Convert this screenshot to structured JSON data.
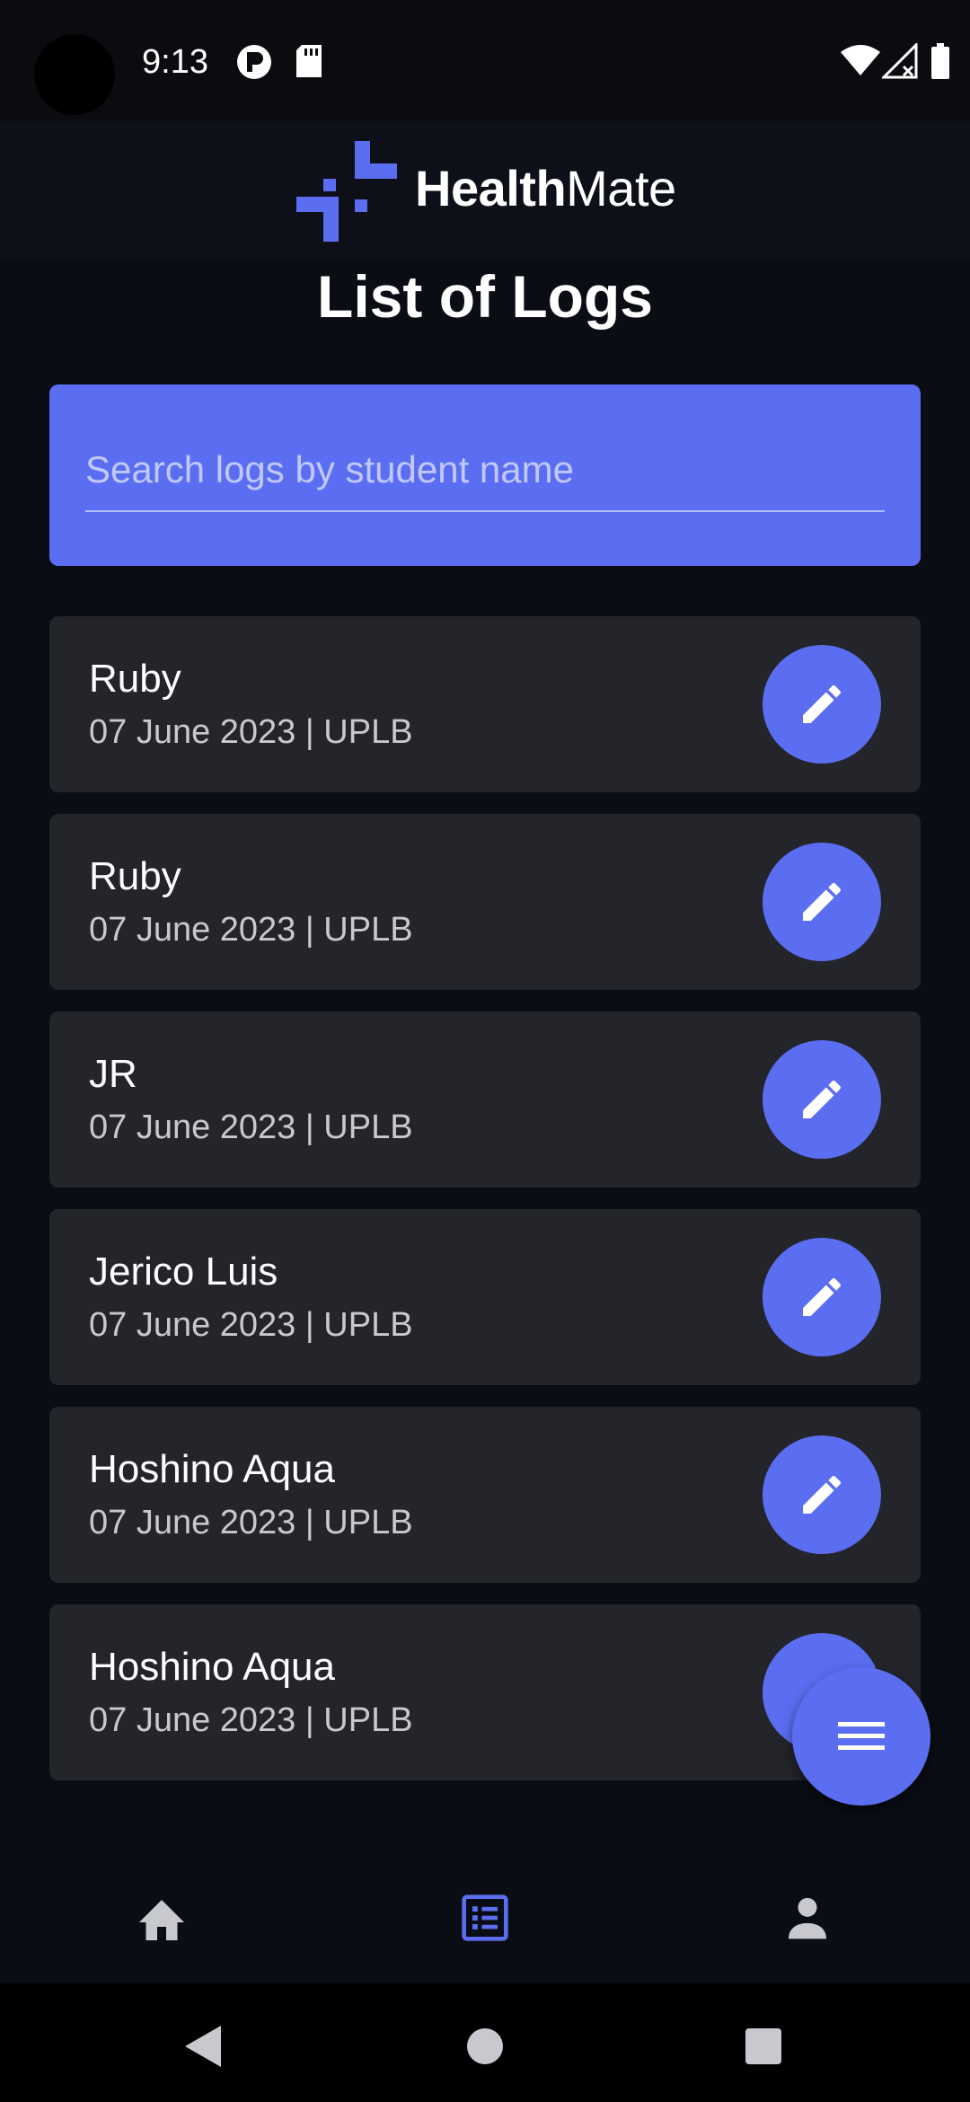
{
  "status_bar": {
    "time": "9:13"
  },
  "header": {
    "brand_bold": "Health",
    "brand_light": "Mate"
  },
  "page": {
    "title": "List of Logs"
  },
  "search": {
    "placeholder": "Search logs by student name",
    "value": ""
  },
  "logs": [
    {
      "name": "Ruby",
      "subtitle": "07 June 2023 | UPLB"
    },
    {
      "name": "Ruby",
      "subtitle": "07 June 2023 | UPLB"
    },
    {
      "name": "JR",
      "subtitle": "07 June 2023 | UPLB"
    },
    {
      "name": "Jerico Luis",
      "subtitle": "07 June 2023 | UPLB"
    },
    {
      "name": "Hoshino Aqua",
      "subtitle": "07 June 2023 | UPLB"
    },
    {
      "name": "Hoshino Aqua",
      "subtitle": "07 June 2023 | UPLB"
    }
  ],
  "bottom_nav": {
    "items": [
      {
        "icon": "home-icon",
        "active": false
      },
      {
        "icon": "list-icon",
        "active": true
      },
      {
        "icon": "person-icon",
        "active": false
      }
    ]
  },
  "colors": {
    "accent": "#5b6ef2",
    "background": "#0a0d14",
    "card": "#23252b",
    "inactive_icon": "#c8c9cf"
  }
}
